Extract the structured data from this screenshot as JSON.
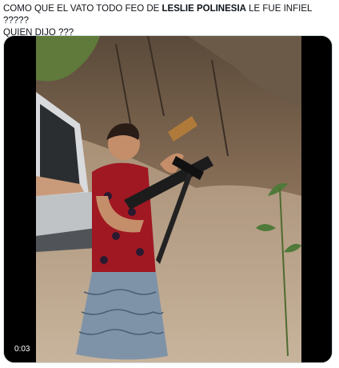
{
  "post": {
    "text_before": "COMO QUE EL VATO TODO FEO DE ",
    "text_bold": "LESLIE POLINESIA",
    "text_after": " LE FUE INFIEL ?????",
    "line2": "QUIEN DIJO ???"
  },
  "media": {
    "type": "video",
    "timestamp": "0:03",
    "icon": "play-video-icon"
  }
}
